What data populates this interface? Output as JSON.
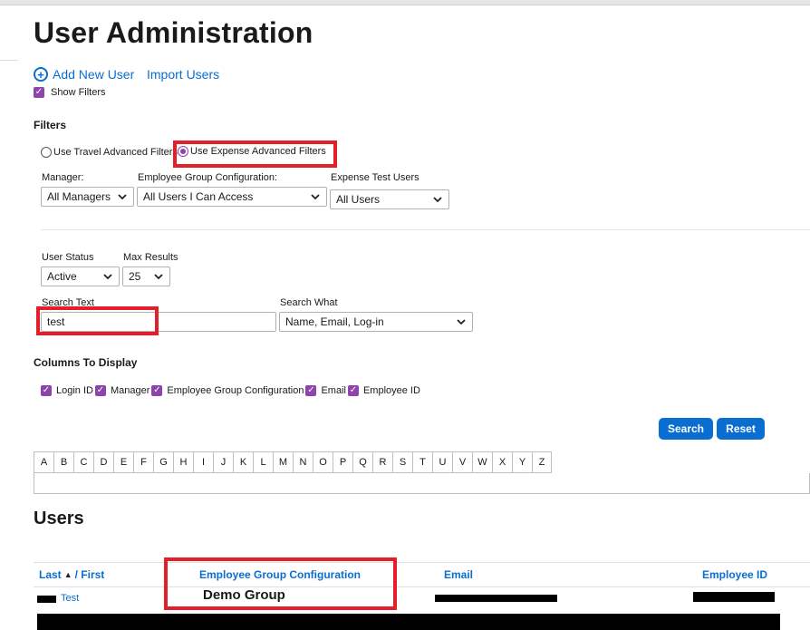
{
  "page": {
    "title": "User Administration"
  },
  "actions": {
    "add_new_user": "Add New User",
    "import_users": "Import Users",
    "show_filters": "Show Filters"
  },
  "filters": {
    "heading": "Filters",
    "travel_radio": "Use Travel Advanced Filters",
    "expense_radio": "Use Expense Advanced Filters",
    "manager_label": "Manager:",
    "manager_value": "All Managers",
    "egc_label": "Employee Group Configuration:",
    "egc_value": "All Users I Can Access",
    "test_users_label": "Expense Test Users",
    "test_users_value": "All Users",
    "user_status_label": "User Status",
    "user_status_value": "Active",
    "max_results_label": "Max Results",
    "max_results_value": "25",
    "search_text_label": "Search Text",
    "search_text_value": "test",
    "search_what_label": "Search What",
    "search_what_value": "Name, Email, Log-in"
  },
  "columns": {
    "heading": "Columns To Display",
    "items": [
      "Login ID",
      "Manager",
      "Employee Group Configuration",
      "Email",
      "Employee ID"
    ]
  },
  "buttons": {
    "search": "Search",
    "reset": "Reset"
  },
  "alphabet": [
    "A",
    "B",
    "C",
    "D",
    "E",
    "F",
    "G",
    "H",
    "I",
    "J",
    "K",
    "L",
    "M",
    "N",
    "O",
    "P",
    "Q",
    "R",
    "S",
    "T",
    "U",
    "V",
    "W",
    "X",
    "Y",
    "Z"
  ],
  "users": {
    "heading": "Users",
    "col_last": "Last",
    "col_first": "/ First",
    "col_egc": "Employee Group Configuration",
    "col_email": "Email",
    "col_empid": "Employee ID",
    "row1_first": "Test",
    "row1_egc": "Demo Group"
  },
  "colors": {
    "accent": "#0a6ed1",
    "checkbox": "#8e44ad",
    "highlight": "#e3202a"
  },
  "icons": {
    "add": "plus-circle-icon",
    "dropdown": "chevron-down-icon",
    "sort": "sort-up-icon"
  }
}
